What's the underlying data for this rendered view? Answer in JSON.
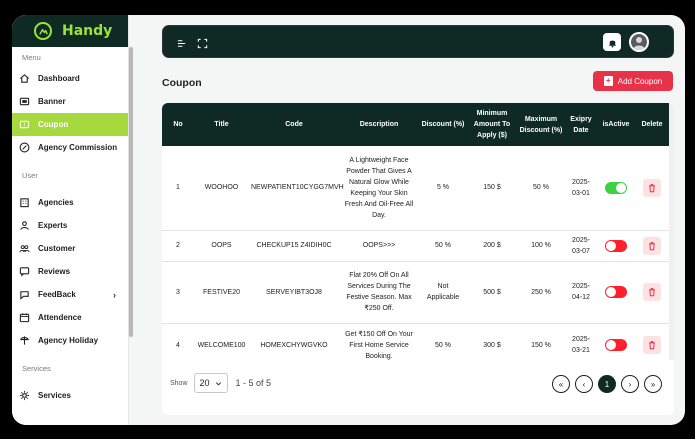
{
  "brand": {
    "name": "Handy"
  },
  "sidebar": {
    "sections": [
      {
        "label": "Menu"
      },
      {
        "label": "User"
      },
      {
        "label": "Services"
      }
    ],
    "items": [
      {
        "label": "Dashboard",
        "icon": "home-icon"
      },
      {
        "label": "Banner",
        "icon": "banner-icon"
      },
      {
        "label": "Coupon",
        "icon": "coupon-icon",
        "active": true
      },
      {
        "label": "Agency Commission",
        "icon": "percent-icon"
      },
      {
        "label": "Agencies",
        "icon": "building-icon"
      },
      {
        "label": "Experts",
        "icon": "expert-icon"
      },
      {
        "label": "Customer",
        "icon": "users-icon"
      },
      {
        "label": "Reviews",
        "icon": "review-icon"
      },
      {
        "label": "FeedBack",
        "icon": "feedback-icon",
        "chevron": "›"
      },
      {
        "label": "Attendence",
        "icon": "calendar-icon"
      },
      {
        "label": "Agency Holiday",
        "icon": "holiday-icon"
      },
      {
        "label": "Services",
        "icon": "services-icon"
      }
    ]
  },
  "page": {
    "title": "Coupon",
    "add_button": "Add Coupon"
  },
  "table": {
    "columns": [
      "No",
      "Title",
      "Code",
      "Description",
      "Discount (%)",
      "Minimum Amount To Apply ($)",
      "Maximum Discount (%)",
      "Exipry Date",
      "isActive",
      "Delete"
    ],
    "rows": [
      {
        "no": "1",
        "title": "WOOHOO",
        "code": "NEWPATIENT10CYGG7MVH",
        "description": "A Lightweight Face Powder That Gives A Natural Glow While Keeping Your Skin Fresh And Oil-Free All Day.",
        "discount": "5 %",
        "min_amount": "150 $",
        "max_discount": "50 %",
        "expiry": "2025-03-01",
        "active": true
      },
      {
        "no": "2",
        "title": "OOPS",
        "code": "CHECKUP15 Z4IDIH0C",
        "description": "OOPS>>>",
        "discount": "50 %",
        "min_amount": "200 $",
        "max_discount": "100 %",
        "expiry": "2025-03-07",
        "active": false
      },
      {
        "no": "3",
        "title": "FESTIVE20",
        "code": "SERVEYIBT3OJ8",
        "description": "Flat 20% Off On All Services During The Festive Season. Max ₹250 Off.",
        "discount": "Not Applicable",
        "min_amount": "500 $",
        "max_discount": "250 %",
        "expiry": "2025-04-12",
        "active": false
      },
      {
        "no": "4",
        "title": "WELCOME100",
        "code": "HOMEXCHYWGVKO",
        "description": "Get ₹150 Off On Your First Home Service Booking.",
        "discount": "50 %",
        "min_amount": "300 $",
        "max_discount": "150 %",
        "expiry": "2025-03-21",
        "active": false
      }
    ]
  },
  "pagination": {
    "show_label": "Show",
    "page_size": "20",
    "range": "1 - 5 of 5",
    "current_page": "1",
    "first": "«",
    "prev": "‹",
    "next": "›",
    "last": "»"
  },
  "colors": {
    "dark": "#0f2a22",
    "accent": "#a5d93e",
    "danger": "#e8324a",
    "toggle_on": "#3bd142",
    "toggle_off": "#ff1f2d"
  }
}
